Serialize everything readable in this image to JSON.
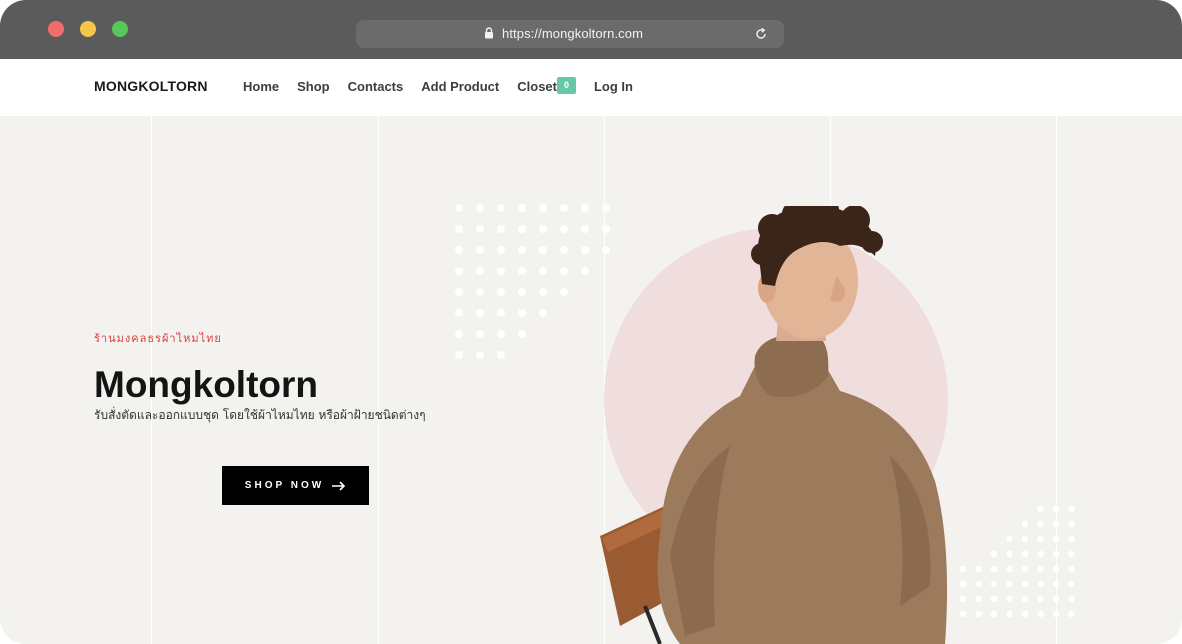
{
  "browser": {
    "url": "https://mongkoltorn.com",
    "icons": {
      "lock": "lock-icon",
      "reload": "reload-icon"
    }
  },
  "nav": {
    "brand": "MONGKOLTORN",
    "links": [
      "Home",
      "Shop",
      "Contacts",
      "Add Product"
    ],
    "closet_label": "Closet",
    "closet_count": "0",
    "login": "Log In"
  },
  "hero": {
    "subtitle": "ร้านมงคลธรผ้าไหมไทย",
    "title": "Mongkoltorn",
    "description": "รับสั่งตัดและออกแบบชุด โดยใช้ผ้าไหมไทย หรือผ้าฝ้ายชนิดต่างๆ",
    "cta": "SHOP NOW",
    "cta_icon": "arrow-right-icon"
  },
  "colors": {
    "accent_red": "#d9413f",
    "badge_green": "#64c8a9",
    "hero_bg": "#f3f2ef",
    "pink_circle": "#efdedd",
    "button_black": "#000000"
  }
}
